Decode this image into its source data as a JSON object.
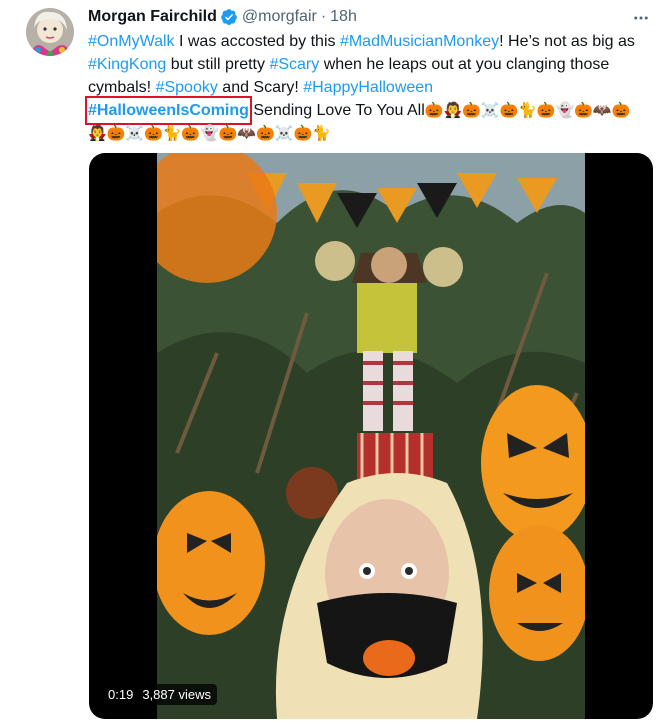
{
  "user": {
    "display_name": "Morgan Fairchild",
    "handle": "@morgfair",
    "separator": "·",
    "timestamp": "18h"
  },
  "tweet": {
    "segments": [
      {
        "text": "#OnMyWalk",
        "type": "hashtag"
      },
      {
        "text": " I was accosted by this ",
        "type": "text"
      },
      {
        "text": "#MadMusicianMonkey",
        "type": "hashtag"
      },
      {
        "text": "! He’s not as big as ",
        "type": "text"
      },
      {
        "text": "#KingKong",
        "type": "hashtag"
      },
      {
        "text": " but still pretty ",
        "type": "text"
      },
      {
        "text": "#Scary",
        "type": "hashtag"
      },
      {
        "text": " when he leaps out at you clanging those cymbals! ",
        "type": "text"
      },
      {
        "text": "#Spooky",
        "type": "hashtag"
      },
      {
        "text": " and Scary! ",
        "type": "text"
      },
      {
        "text": "#HappyHalloween",
        "type": "hashtag"
      },
      {
        "text": "#HalloweenIsComing",
        "type": "highlight"
      },
      {
        "text": " Sending Love To You All",
        "type": "text"
      },
      {
        "text": "🎃🧛🎃☠️🎃🐈🎃👻🎃🦇🎃🧛🎃☠️🎃🐈🎃👻🎃🦇🎃☠️🎃🐈",
        "type": "emoji"
      }
    ]
  },
  "video": {
    "duration": "0:19",
    "views": "3,887 views"
  },
  "colors": {
    "link": "#1d9bf0",
    "highlight_box": "#e0102b",
    "verified": "#1d9bf0"
  },
  "icons": {
    "verified": "verified-badge-icon",
    "more": "more-options-icon"
  }
}
